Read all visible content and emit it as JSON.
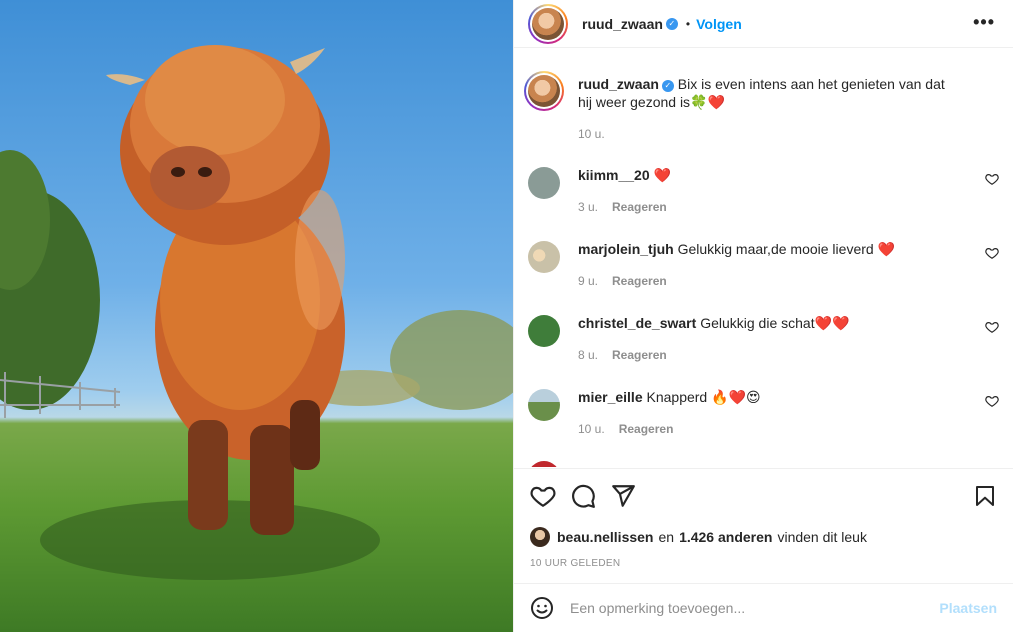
{
  "header": {
    "username": "ruud_zwaan",
    "separator": "•",
    "follow_label": "Volgen",
    "more_label": "•••"
  },
  "caption": {
    "username": "ruud_zwaan",
    "text": "Bix is even intens aan het genieten van dat hij weer gezond is🍀❤️",
    "time": "10 u."
  },
  "comments": [
    {
      "username": "kiimm__20",
      "text": "❤️",
      "time": "3 u.",
      "reply_label": "Reageren",
      "avatar_color": "#8a9b96"
    },
    {
      "username": "marjolein_tjuh",
      "text": "Gelukkig maar,de mooie lieverd ❤️",
      "time": "9 u.",
      "reply_label": "Reageren",
      "avatar_color": "#c9c1a8"
    },
    {
      "username": "christel_de_swart",
      "text": "Gelukkig die schat❤️❤️",
      "time": "8 u.",
      "reply_label": "Reageren",
      "avatar_color": "#3f7d3a"
    },
    {
      "username": "mier_eille",
      "text": "Knapperd 🔥❤️😍",
      "time": "10 u.",
      "reply_label": "Reageren",
      "avatar_color": "#6a8f4a"
    }
  ],
  "likes": {
    "user": "beau.nellissen",
    "connector": "en",
    "count": "1.426 anderen",
    "suffix": "vinden dit leuk"
  },
  "posted_ago": "10 UUR GELEDEN",
  "add_comment": {
    "placeholder": "Een opmerking toevoegen...",
    "post_label": "Plaatsen"
  },
  "colors": {
    "accent": "#0095f6",
    "post_disabled": "#b2dffc",
    "muted": "#8e8e8e"
  },
  "icons": [
    "heart-icon",
    "comment-icon",
    "share-icon",
    "bookmark-icon",
    "emoji-icon",
    "verified-icon"
  ]
}
